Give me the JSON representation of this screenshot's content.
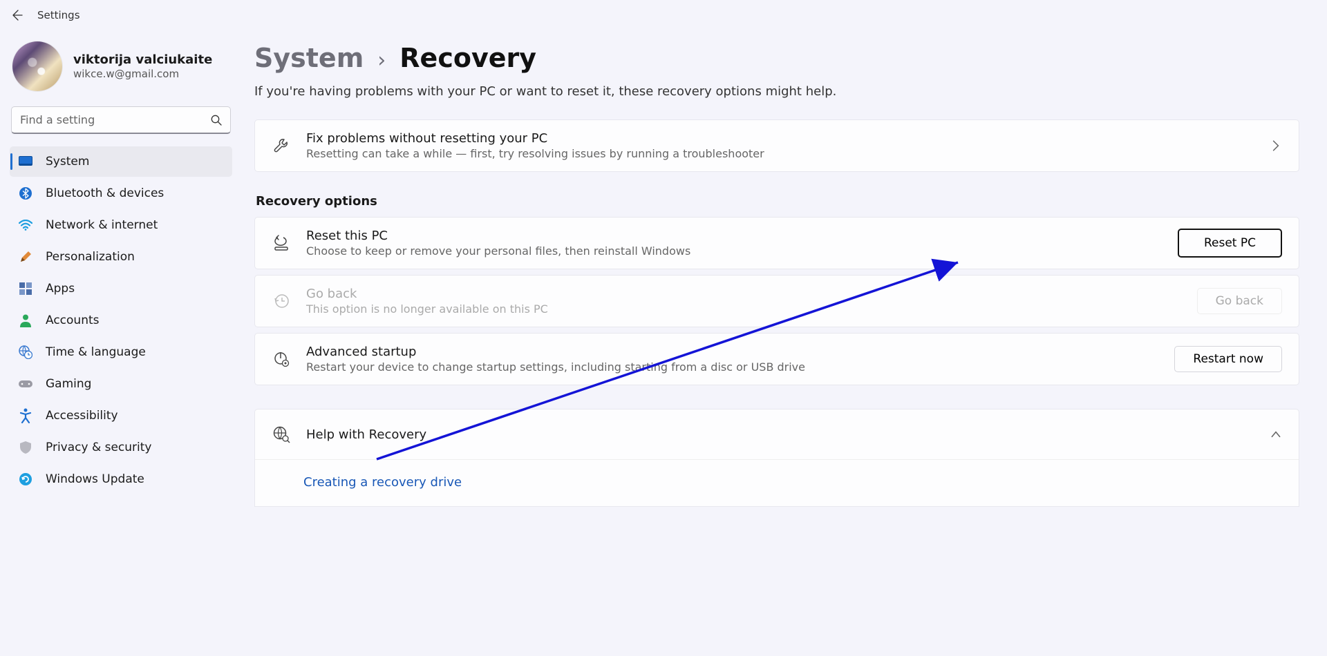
{
  "window": {
    "title": "Settings"
  },
  "user": {
    "name": "viktorija valciukaite",
    "email": "wikce.w@gmail.com"
  },
  "search": {
    "placeholder": "Find a setting"
  },
  "nav": [
    {
      "label": "System",
      "active": true
    },
    {
      "label": "Bluetooth & devices"
    },
    {
      "label": "Network & internet"
    },
    {
      "label": "Personalization"
    },
    {
      "label": "Apps"
    },
    {
      "label": "Accounts"
    },
    {
      "label": "Time & language"
    },
    {
      "label": "Gaming"
    },
    {
      "label": "Accessibility"
    },
    {
      "label": "Privacy & security"
    },
    {
      "label": "Windows Update"
    }
  ],
  "breadcrumb": {
    "parent": "System",
    "current": "Recovery"
  },
  "subtitle": "If you're having problems with your PC or want to reset it, these recovery options might help.",
  "troubleshoot": {
    "title": "Fix problems without resetting your PC",
    "sub": "Resetting can take a while — first, try resolving issues by running a troubleshooter"
  },
  "recovery_section": "Recovery options",
  "reset": {
    "title": "Reset this PC",
    "sub": "Choose to keep or remove your personal files, then reinstall Windows",
    "button": "Reset PC"
  },
  "goback": {
    "title": "Go back",
    "sub": "This option is no longer available on this PC",
    "button": "Go back"
  },
  "advanced": {
    "title": "Advanced startup",
    "sub": "Restart your device to change startup settings, including starting from a disc or USB drive",
    "button": "Restart now"
  },
  "help": {
    "title": "Help with Recovery",
    "link": "Creating a recovery drive"
  }
}
